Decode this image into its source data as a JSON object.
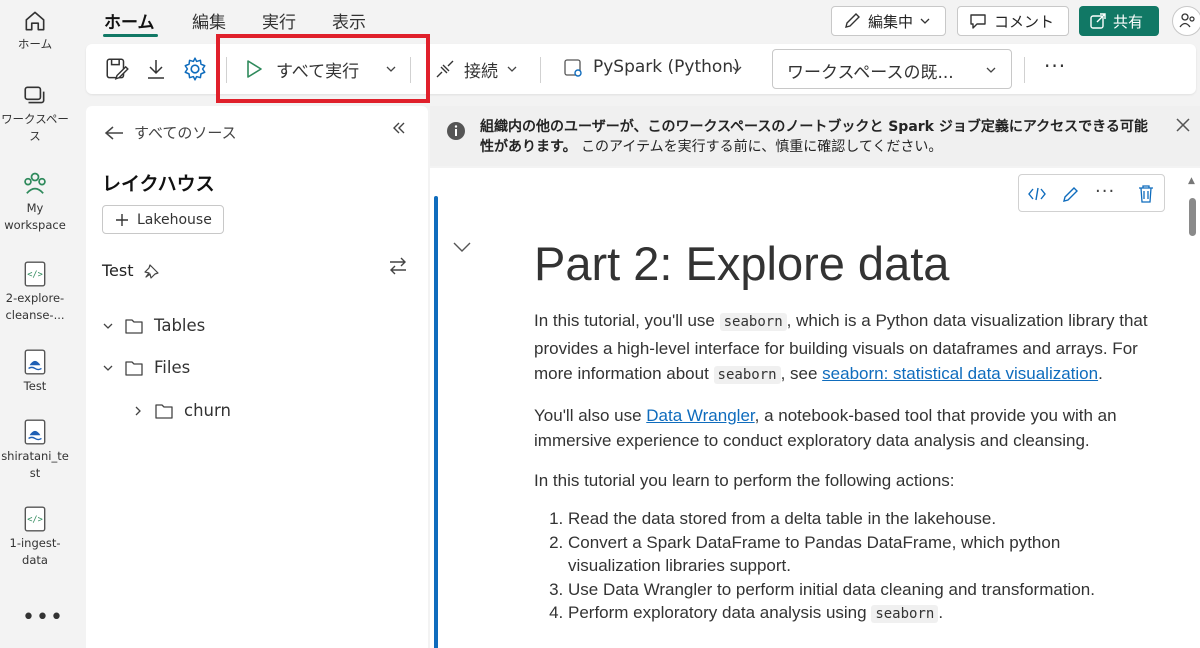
{
  "rail": {
    "items": [
      {
        "label": "ホーム",
        "icon": "home-icon"
      },
      {
        "label": "ワークスペース",
        "icon": "workspaces-icon"
      },
      {
        "label": "My workspace",
        "icon": "my-workspace-icon"
      },
      {
        "label": "2-explore-cleanse-...",
        "icon": "notebook-icon"
      },
      {
        "label": "Test",
        "icon": "lakehouse-icon"
      },
      {
        "label": "shiratani_test",
        "icon": "lakehouse-icon"
      },
      {
        "label": "1-ingest-data",
        "icon": "notebook-icon"
      }
    ],
    "more": "•••"
  },
  "tabs": [
    "ホーム",
    "編集",
    "実行",
    "表示"
  ],
  "header": {
    "editing_label": "編集中",
    "comment_label": "コメント",
    "share_label": "共有"
  },
  "toolbar": {
    "run_all_label": "すべて実行",
    "connect_label": "接続",
    "language_label": "PySpark (Python)",
    "workspace_select": "ワークスペースの既...",
    "more": "···"
  },
  "explorer": {
    "back_label": "すべてのソース",
    "heading": "レイクハウス",
    "add_button": "Lakehouse",
    "lakehouse_name": "Test",
    "tree": [
      {
        "label": "Tables",
        "expanded": true,
        "depth": 0
      },
      {
        "label": "Files",
        "expanded": true,
        "depth": 0
      },
      {
        "label": "churn",
        "expanded": false,
        "depth": 1
      }
    ]
  },
  "notice": {
    "bold_text": "組織内の他のユーザーが、このワークスペースのノートブックと Spark ジョブ定義にアクセスできる可能性があります。",
    "normal_text": "このアイテムを実行する前に、慎重に確認してください。"
  },
  "cell": {
    "title": "Part 2: Explore data",
    "p1_a": "In this tutorial, you'll use ",
    "p1_code1": "seaborn",
    "p1_b": ", which is a Python data visualization library that provides a high-level interface for building visuals on dataframes and arrays. For more information about ",
    "p1_code2": "seaborn",
    "p1_c": ", see ",
    "p1_link": "seaborn: statistical data visualization",
    "p1_d": ".",
    "p2_a": "You'll also use ",
    "p2_link": "Data Wrangler",
    "p2_b": ", a notebook-based tool that provide you with an immersive experience to conduct exploratory data analysis and cleansing.",
    "p3": "In this tutorial you learn to perform the following actions:",
    "list": [
      "Read the data stored from a delta table in the lakehouse.",
      "Convert a Spark DataFrame to Pandas DataFrame, which python visualization libraries support.",
      "Use Data Wrangler to perform initial data cleaning and transformation."
    ],
    "list4_a": "Perform exploratory data analysis using ",
    "list4_code": "seaborn",
    "list4_b": "."
  },
  "colors": {
    "accent": "#117865",
    "link": "#0f6cbd",
    "highlight": "#e0202b"
  }
}
